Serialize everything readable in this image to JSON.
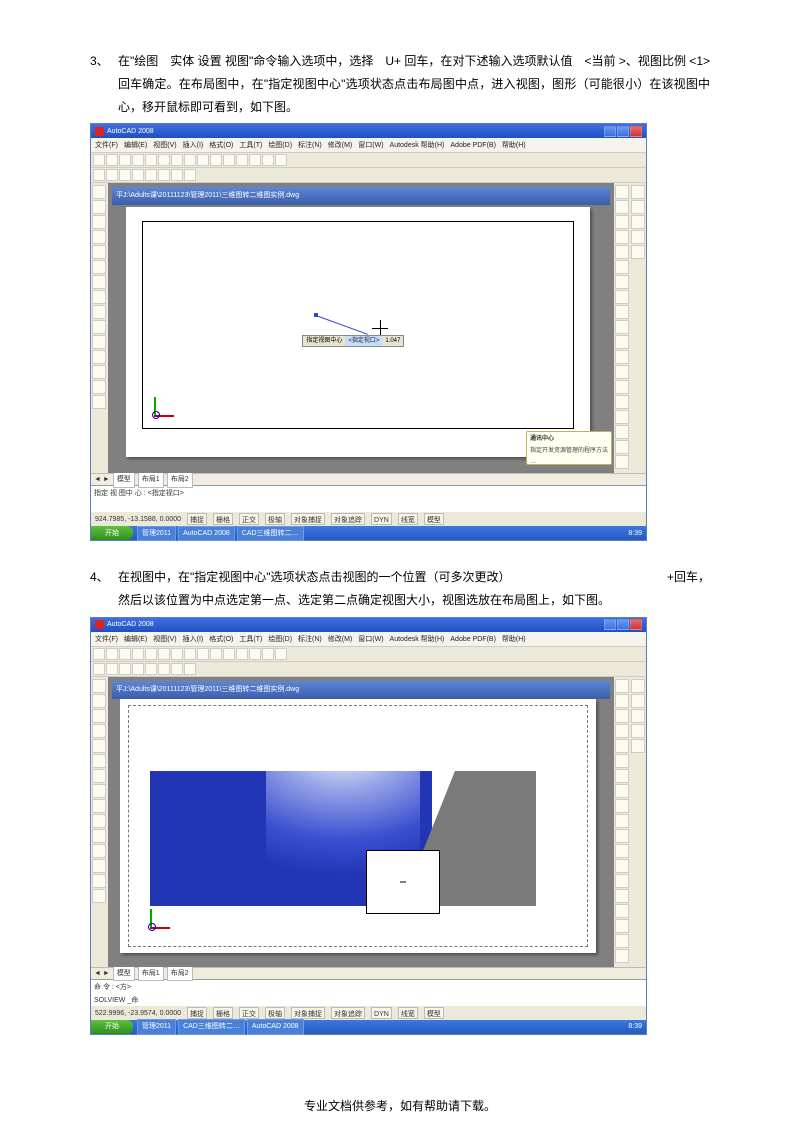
{
  "step3": {
    "num": "3、",
    "text": "在\"绘图　实体 设置 视图\"命令输入选项中，选择　U+ 回车，在对下述输入选项默认值　<当前 >、视图比例 <1>回车确定。在布局图中，在\"指定视图中心\"选项状态点击布局图中点，进入视图，图形（可能很小）在该视图中心，移开鼠标即可看到，如下图。"
  },
  "step4": {
    "num": "4、",
    "text_a": "在视图中，在\"指定视图中心\"选项状态点击视图的一个位置（可多次更改）",
    "text_b": "+回车，",
    "text_c": "然后以该位置为中点选定第一点、选定第二点确定视图大小，视图选放在布局图上，如下图。"
  },
  "app": {
    "title": "AutoCAD 2008",
    "doc_title": "平J:\\Adults课\\20111123\\管理2011\\三维图转二维图实例.dwg",
    "menus": [
      "文件(F)",
      "编辑(E)",
      "视图(V)",
      "插入(I)",
      "格式(O)",
      "工具(T)",
      "绘图(D)",
      "标注(N)",
      "修改(M)",
      "窗口(W)",
      "Autodesk 帮助(H)",
      "Adobe PDF(B)",
      "帮助(H)"
    ],
    "tooltip_cmd": "指定视图中心",
    "tooltip_inp": "<指定视口>",
    "tooltip_val": "1.047",
    "help_title": "通讯中心",
    "help_body": "指定开发资源管理的程序方法 …",
    "cmdline1": "指定 视 图中 心 : <指定视口>",
    "status_coords1": "924.7985, -13.1588, 0.0000",
    "status_coords2": "522.9996, -23.9574, 0.0000",
    "status_btns": [
      "捕捉",
      "栅格",
      "正交",
      "极轴",
      "对象捕捉",
      "对象追踪",
      "DYN",
      "线宽",
      "模型"
    ],
    "tabs": [
      "模型",
      "布局1",
      "布局2"
    ],
    "taskbar": {
      "start": "开始",
      "items": [
        "管理2011",
        "AutoCAD 2008",
        "CAD三维图转二…"
      ],
      "time": "8:39"
    },
    "taskbar2": {
      "items": [
        "管理2011",
        "CAD三维图转二…",
        "AutoCAD 2008"
      ]
    }
  },
  "footer": "专业文档供参考，如有帮助请下载。"
}
